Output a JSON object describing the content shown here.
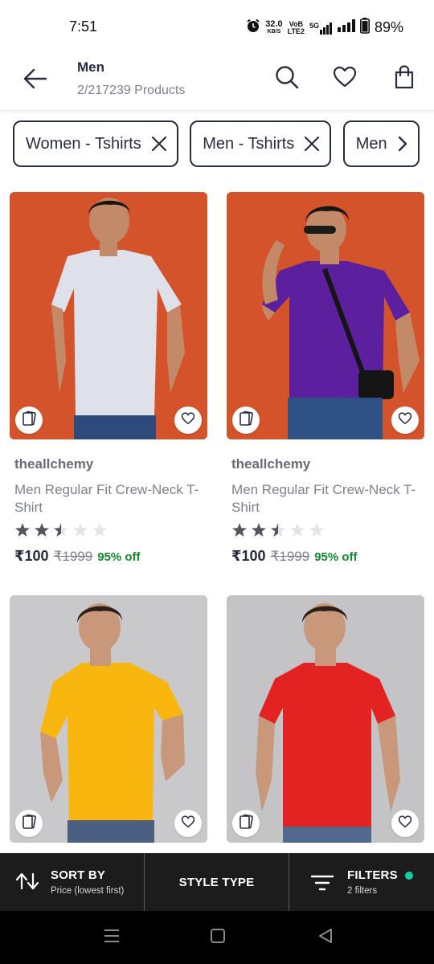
{
  "status_bar": {
    "time": "7:51",
    "speed_value": "32.0",
    "speed_unit": "KB/S",
    "volte_top": "VoB",
    "volte_bottom": "LTE2",
    "network": "5G",
    "battery": "89%"
  },
  "header": {
    "title": "Men",
    "subtitle": "2/217239 Products",
    "icons": [
      "back-arrow-icon",
      "search-icon",
      "heart-icon",
      "bag-icon"
    ]
  },
  "filter_chips": [
    {
      "label": "Women - Tshirts",
      "icon": "close-icon"
    },
    {
      "label": "Men - Tshirts",
      "icon": "close-icon"
    },
    {
      "label": "Men",
      "icon": "chevron-right-icon"
    }
  ],
  "products": [
    {
      "brand": "theallchemy",
      "name": "Men Regular Fit Crew-Neck T-Shirt",
      "price": "₹100",
      "mrp": "₹1999",
      "discount": "95% off",
      "rating": 2.5,
      "background": "#d4532b",
      "shirt_color": "#dfe1ea"
    },
    {
      "brand": "theallchemy",
      "name": "Men Regular Fit Crew-Neck T-Shirt",
      "price": "₹100",
      "mrp": "₹1999",
      "discount": "95% off",
      "rating": 2.5,
      "background": "#d4532b",
      "shirt_color": "#5c1f9e"
    },
    {
      "brand": "",
      "name": "",
      "price": "",
      "mrp": "",
      "discount": "",
      "rating": null,
      "background": "#c9c9cb",
      "shirt_color": "#f8b60e"
    },
    {
      "brand": "",
      "name": "",
      "price": "",
      "mrp": "",
      "discount": "",
      "rating": null,
      "background": "#c4c4c6",
      "shirt_color": "#e32222"
    }
  ],
  "bottom_bar": {
    "sort_label": "SORT BY",
    "sort_value": "Price (lowest first)",
    "style_label": "STYLE TYPE",
    "filter_label": "FILTERS",
    "filter_value": "2 filters"
  },
  "colors": {
    "accent_green": "#148a2f",
    "filter_dot": "#14cda8",
    "bar_bg": "#1c1c1c",
    "text_primary": "#282c3f"
  }
}
